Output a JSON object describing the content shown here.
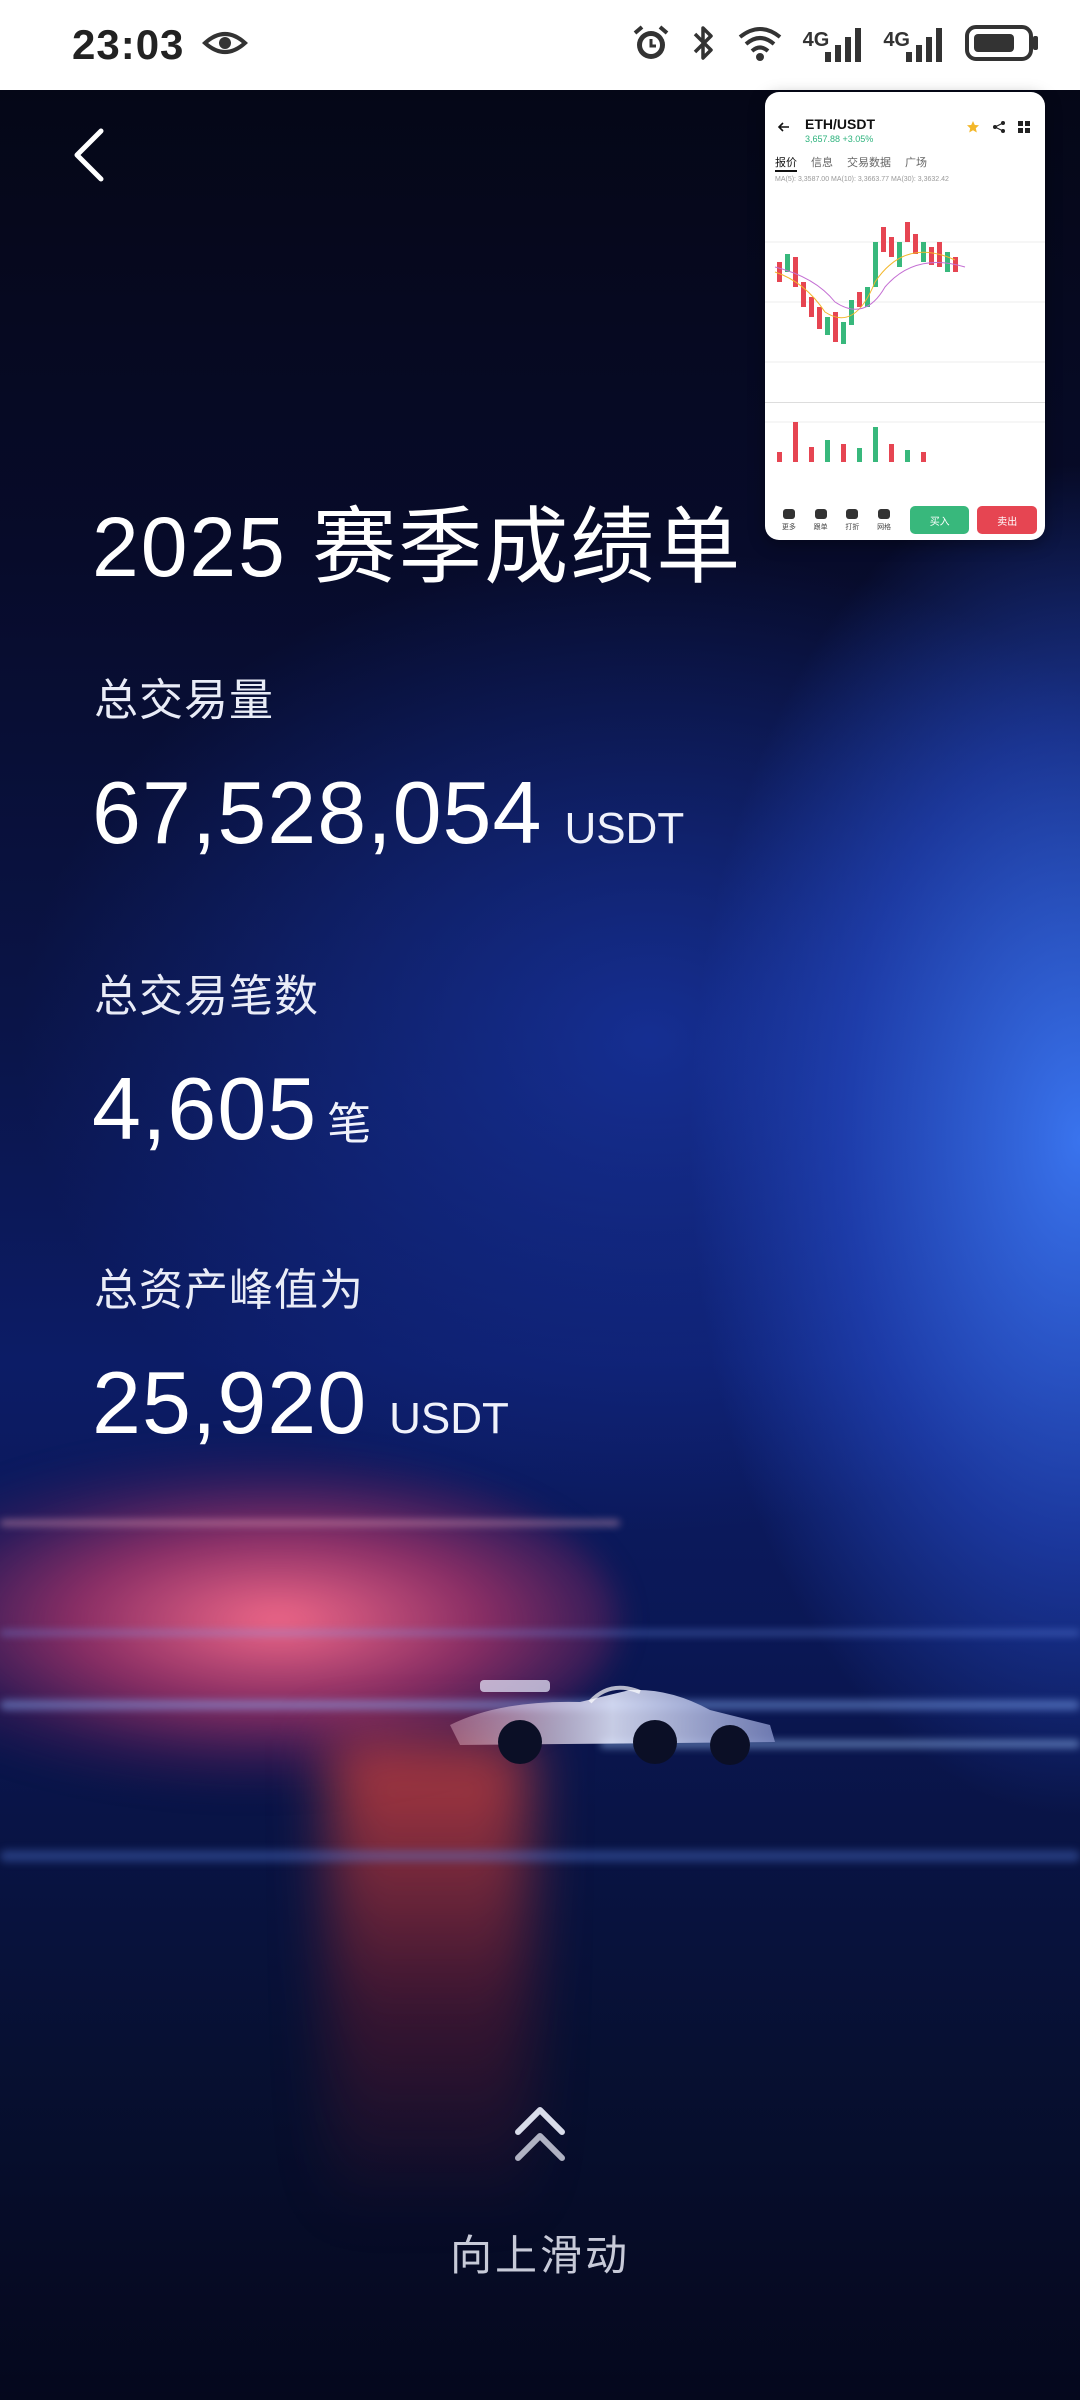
{
  "status_bar": {
    "time": "23:03",
    "signal_1_label": "4G",
    "signal_2_label": "4G",
    "icons": [
      "eye-icon",
      "alarm-icon",
      "bluetooth-icon",
      "wifi-icon",
      "signal-icon",
      "battery-icon"
    ]
  },
  "header": {
    "back_icon": "chevron-left-icon"
  },
  "report": {
    "title": "2025 赛季成绩单",
    "metrics": [
      {
        "label": "总交易量",
        "value": "67,528,054",
        "unit": "USDT"
      },
      {
        "label": "总交易笔数",
        "value": "4,605",
        "unit": "笔"
      },
      {
        "label": "总资产峰值为",
        "value": "25,920",
        "unit": "USDT"
      }
    ]
  },
  "swipe": {
    "icon": "double-chevron-up-icon",
    "label": "向上滑动"
  },
  "pip": {
    "pair": "ETH/USDT",
    "price_change": "3,657.88 +3.05%",
    "tabs": [
      "报价",
      "信息",
      "交易数据",
      "广场"
    ],
    "indicators": "MA(5): 3,3587.00   MA(10): 3,3663.77   MA(30): 3,3632.42",
    "bottom_items": [
      "更多",
      "跟单",
      "打折",
      "网格"
    ],
    "buy_label": "买入",
    "sell_label": "卖出"
  },
  "colors": {
    "accent_up": "#38b87c",
    "accent_down": "#e64552",
    "background_top": "#050717",
    "background_blue": "#3c78f5"
  }
}
